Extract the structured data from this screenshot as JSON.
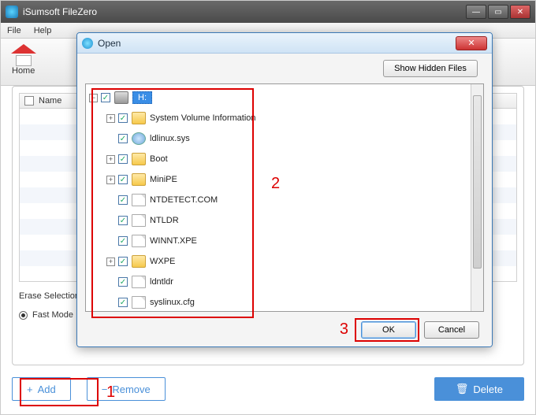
{
  "app": {
    "title": "iSumsoft FileZero"
  },
  "menu": {
    "file": "File",
    "help": "Help"
  },
  "toolbar": {
    "home": "Home"
  },
  "list": {
    "name_col": "Name"
  },
  "erase": {
    "label": "Erase Selection",
    "fast": "Fast Mode"
  },
  "buttons": {
    "add": "Add",
    "remove": "Remove",
    "delete": "Delete"
  },
  "annotations": {
    "n1": "1",
    "n2": "2",
    "n3": "3"
  },
  "dialog": {
    "title": "Open",
    "show_hidden": "Show Hidden Files",
    "ok": "OK",
    "cancel": "Cancel",
    "tree": {
      "root": "H:",
      "items": [
        {
          "label": "System Volume Information",
          "type": "folder",
          "exp": "+",
          "chk": true
        },
        {
          "label": "ldlinux.sys",
          "type": "sys",
          "exp": "",
          "chk": true
        },
        {
          "label": "Boot",
          "type": "folder",
          "exp": "+",
          "chk": true
        },
        {
          "label": "MiniPE",
          "type": "folder",
          "exp": "+",
          "chk": true
        },
        {
          "label": "NTDETECT.COM",
          "type": "file",
          "exp": "",
          "chk": true
        },
        {
          "label": "NTLDR",
          "type": "file",
          "exp": "",
          "chk": true
        },
        {
          "label": "WINNT.XPE",
          "type": "file",
          "exp": "",
          "chk": true
        },
        {
          "label": "WXPE",
          "type": "folder",
          "exp": "+",
          "chk": true
        },
        {
          "label": "ldntldr",
          "type": "file",
          "exp": "",
          "chk": true
        },
        {
          "label": "syslinux.cfg",
          "type": "file",
          "exp": "",
          "chk": true
        }
      ]
    }
  }
}
